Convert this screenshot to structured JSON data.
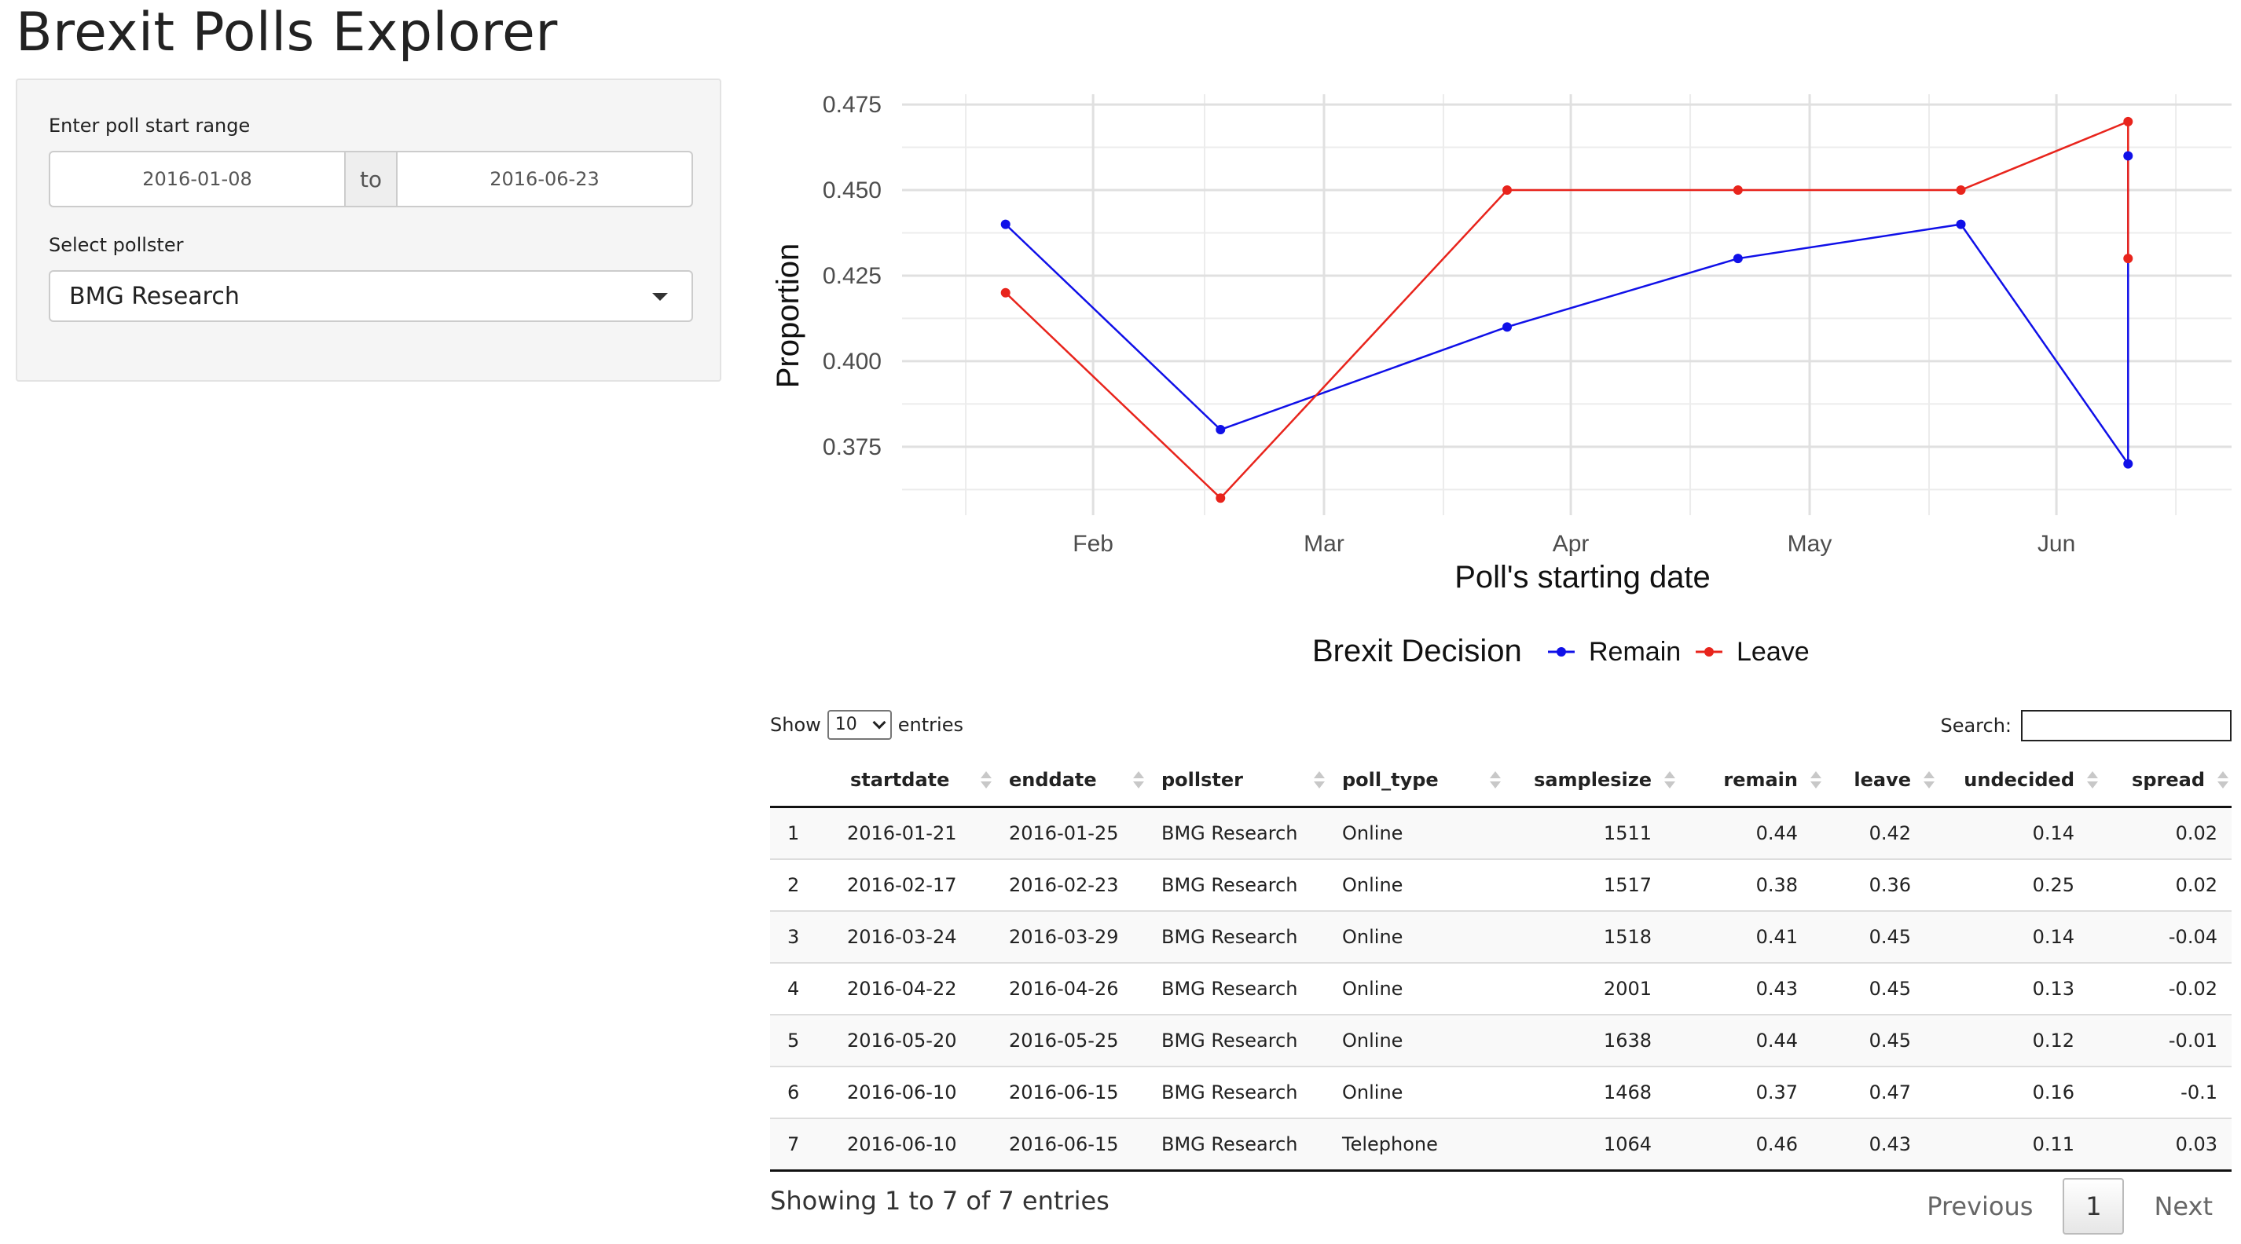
{
  "app": {
    "title": "Brexit Polls Explorer"
  },
  "sidebar": {
    "date_range_label": "Enter poll start range",
    "start_date": "2016-01-08",
    "separator": "to",
    "end_date": "2016-06-23",
    "pollster_label": "Select pollster",
    "pollster_value": "BMG Research"
  },
  "chart_data": {
    "type": "line",
    "xlabel": "Poll's starting date",
    "ylabel": "Proportion",
    "x_ticks": [
      "Feb",
      "Mar",
      "Apr",
      "May",
      "Jun"
    ],
    "y_ticks": [
      "0.375",
      "0.400",
      "0.425",
      "0.450",
      "0.475"
    ],
    "ylim": [
      0.355,
      0.478
    ],
    "legend_title": "Brexit Decision",
    "legend_position": "bottom",
    "grid": true,
    "series": [
      {
        "name": "Remain",
        "color": "#1010e8",
        "x": [
          "2016-01-21",
          "2016-02-17",
          "2016-03-24",
          "2016-04-22",
          "2016-05-20",
          "2016-06-10",
          "2016-06-10"
        ],
        "y": [
          0.44,
          0.38,
          0.41,
          0.43,
          0.44,
          0.37,
          0.46
        ]
      },
      {
        "name": "Leave",
        "color": "#e8241c",
        "x": [
          "2016-01-21",
          "2016-02-17",
          "2016-03-24",
          "2016-04-22",
          "2016-05-20",
          "2016-06-10",
          "2016-06-10"
        ],
        "y": [
          0.42,
          0.36,
          0.45,
          0.45,
          0.45,
          0.47,
          0.43
        ]
      }
    ]
  },
  "table": {
    "show_label": "Show",
    "length_value": "10",
    "entries_label": "entries",
    "search_label": "Search:",
    "columns": [
      "",
      "startdate",
      "enddate",
      "pollster",
      "poll_type",
      "samplesize",
      "remain",
      "leave",
      "undecided",
      "spread"
    ],
    "rows": [
      [
        "1",
        "2016-01-21",
        "2016-01-25",
        "BMG Research",
        "Online",
        "1511",
        "0.44",
        "0.42",
        "0.14",
        "0.02"
      ],
      [
        "2",
        "2016-02-17",
        "2016-02-23",
        "BMG Research",
        "Online",
        "1517",
        "0.38",
        "0.36",
        "0.25",
        "0.02"
      ],
      [
        "3",
        "2016-03-24",
        "2016-03-29",
        "BMG Research",
        "Online",
        "1518",
        "0.41",
        "0.45",
        "0.14",
        "-0.04"
      ],
      [
        "4",
        "2016-04-22",
        "2016-04-26",
        "BMG Research",
        "Online",
        "2001",
        "0.43",
        "0.45",
        "0.13",
        "-0.02"
      ],
      [
        "5",
        "2016-05-20",
        "2016-05-25",
        "BMG Research",
        "Online",
        "1638",
        "0.44",
        "0.45",
        "0.12",
        "-0.01"
      ],
      [
        "6",
        "2016-06-10",
        "2016-06-15",
        "BMG Research",
        "Online",
        "1468",
        "0.37",
        "0.47",
        "0.16",
        "-0.1"
      ],
      [
        "7",
        "2016-06-10",
        "2016-06-15",
        "BMG Research",
        "Telephone",
        "1064",
        "0.46",
        "0.43",
        "0.11",
        "0.03"
      ]
    ],
    "info": "Showing 1 to 7 of 7 entries",
    "previous": "Previous",
    "current_page": "1",
    "next": "Next"
  }
}
